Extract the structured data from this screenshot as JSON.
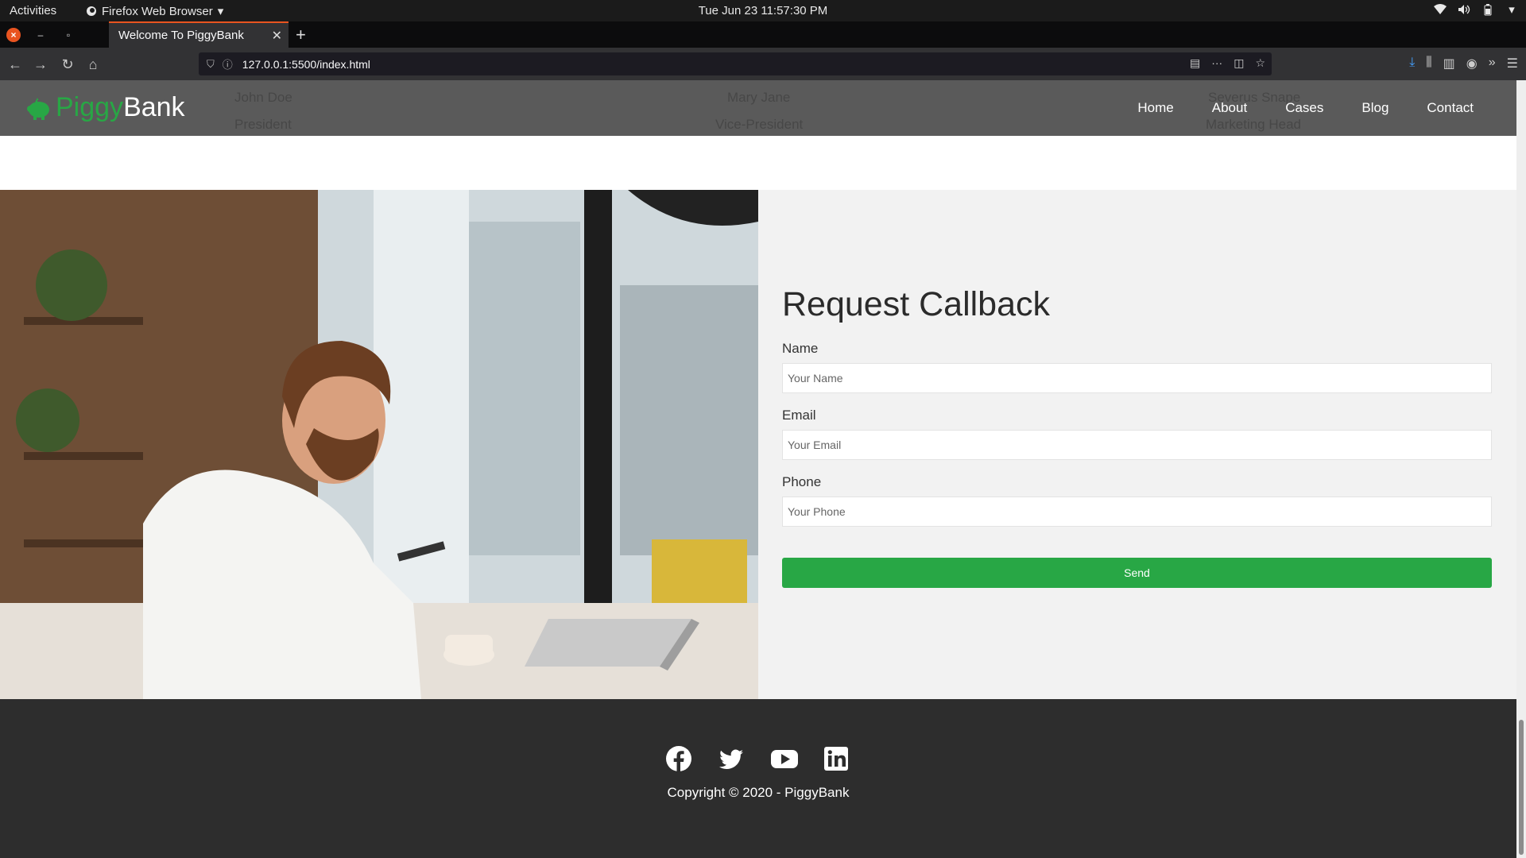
{
  "system": {
    "activities": "Activities",
    "app_name": "Firefox Web Browser",
    "clock": "Tue Jun 23  11:57:30 PM"
  },
  "browser": {
    "tab_title": "Welcome To PiggyBank",
    "url": "127.0.0.1:5500/index.html"
  },
  "site": {
    "logo_part1": "Piggy",
    "logo_part2": "Bank",
    "nav": [
      "Home",
      "About",
      "Cases",
      "Blog",
      "Contact"
    ],
    "ghost_team": [
      {
        "name": "John Doe",
        "role": "President"
      },
      {
        "name": "Mary Jane",
        "role": "Vice-President"
      },
      {
        "name": "Severus Snape",
        "role": "Marketing Head"
      }
    ]
  },
  "callback": {
    "title": "Request Callback",
    "fields": [
      {
        "label": "Name",
        "placeholder": "Your Name"
      },
      {
        "label": "Email",
        "placeholder": "Your Email"
      },
      {
        "label": "Phone",
        "placeholder": "Your Phone"
      }
    ],
    "send_label": "Send"
  },
  "footer": {
    "socials": [
      "facebook-icon",
      "twitter-icon",
      "youtube-icon",
      "linkedin-icon"
    ],
    "copyright": "Copyright © 2020 - PiggyBank"
  },
  "colors": {
    "accent": "#28a745",
    "header_bg": "#5a5a5a",
    "footer_bg": "#2d2d2d",
    "ubuntu_orange": "#e95420"
  }
}
